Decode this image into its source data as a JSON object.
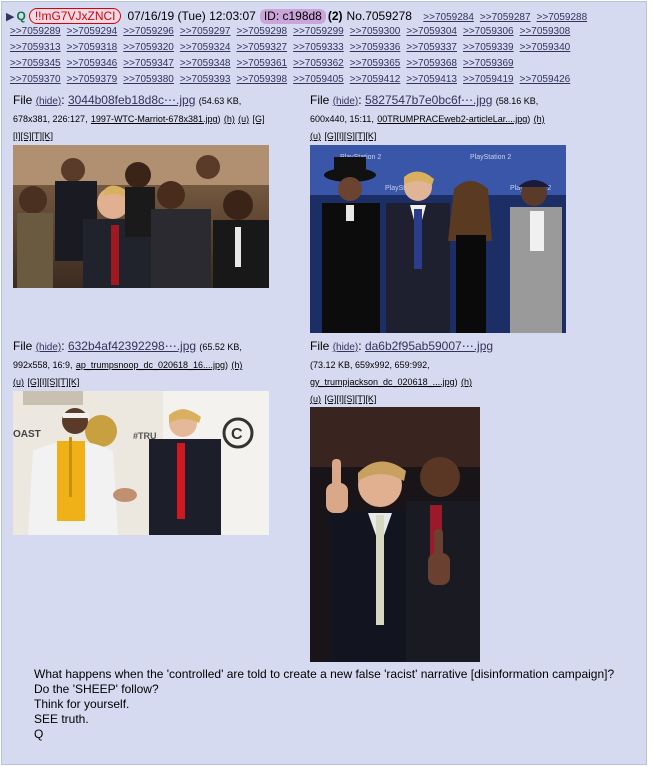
{
  "header": {
    "arrow": "▶",
    "name": "Q",
    "tripcode": "!!mG7VJxZNCI",
    "datetime": "07/16/19 (Tue) 12:03:07",
    "id_label": "ID: c198d8",
    "reply_count": "(2)",
    "post_no": "No.7059278"
  },
  "backlinks": [
    [
      ">>7059284",
      ">>7059287",
      ">>7059288"
    ],
    [
      ">>7059289",
      ">>7059294",
      ">>7059296",
      ">>7059297",
      ">>7059298",
      ">>7059299",
      ">>7059300",
      ">>7059304",
      ">>7059306",
      ">>7059308"
    ],
    [
      ">>7059313",
      ">>7059318",
      ">>7059320",
      ">>7059324",
      ">>7059327",
      ">>7059333",
      ">>7059336",
      ">>7059337",
      ">>7059339",
      ">>7059340"
    ],
    [
      ">>7059345",
      ">>7059346",
      ">>7059347",
      ">>7059348",
      ">>7059361",
      ">>7059362",
      ">>7059365",
      ">>7059368",
      ">>7059369"
    ],
    [
      ">>7059370",
      ">>7059379",
      ">>7059380",
      ">>7059393",
      ">>7059398",
      ">>7059405",
      ">>7059412",
      ">>7059413",
      ">>7059419",
      ">>7059426"
    ]
  ],
  "files": [
    {
      "label": "File",
      "hide": "(hide)",
      "name": "3044b08feb18d8c⋯.jpg",
      "size": "(54.63 KB,",
      "dims": "678x381, 226:127,",
      "orig": "1997-WTC-Marriot-678x381.jpg",
      "close": ")",
      "tools1": [
        "(h)",
        "(u)",
        "[G]"
      ],
      "tools2": [
        "[I]",
        "[S]",
        "[T]",
        "[K]"
      ]
    },
    {
      "label": "File",
      "hide": "(hide)",
      "name": "5827547b7e0bc6f⋯.jpg",
      "size": "(58.16 KB,",
      "dims": "600x440, 15:11,",
      "orig": "00TRUMPRACEweb2-articleLar....jpg",
      "close": ")",
      "tools1": [
        "(h)"
      ],
      "tools2": [
        "(u)",
        "[G]",
        "[I]",
        "[S]",
        "[T]",
        "[K]"
      ]
    },
    {
      "label": "File",
      "hide": "(hide)",
      "name": "632b4af42392298⋯.jpg",
      "size": "(65.52 KB,",
      "dims": "992x558, 16:9,",
      "orig": "ap_trumpsnoop_dc_020618_16....jpg",
      "close": ")",
      "tools1": [
        "(h)"
      ],
      "tools2": [
        "(u)",
        "[G]",
        "[I]",
        "[S]",
        "[T]",
        "[K]"
      ]
    },
    {
      "label": "File",
      "hide": "(hide)",
      "name": "da6b2f95ab59007⋯.jpg",
      "size": "(73.12 KB, 659x992, 659:992,",
      "dims": "",
      "orig": "gy_trumpjackson_dc_020618_....jpg",
      "close": ")",
      "tools1": [
        "(h)"
      ],
      "tools2": [
        "(u)",
        "[G]",
        "[I]",
        "[S]",
        "[T]",
        "[K]"
      ]
    }
  ],
  "image_text": {
    "img2_banner": "PlayStation 2",
    "img3_left": "OAST",
    "img3_mid": "#TRU"
  },
  "body": [
    "What happens when the 'controlled' are told to create a new false 'racist' narrative [disinformation campaign]?",
    "Do the 'SHEEP' follow?",
    "Think for yourself.",
    "SEE truth.",
    "Q"
  ],
  "colors": {
    "post_bg": "#d6daf0",
    "link": "#34345c",
    "name": "#117743",
    "trip": "#dd0000",
    "id_bg": "#cba5da"
  }
}
